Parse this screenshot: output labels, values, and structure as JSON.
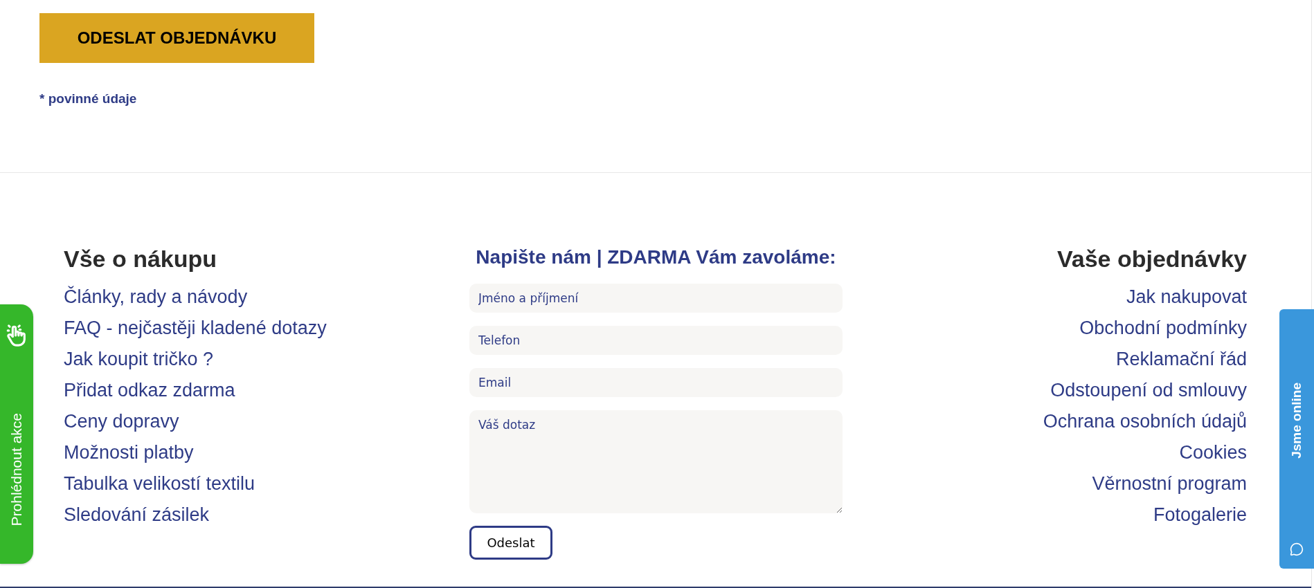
{
  "order_form": {
    "submit_button": "ODESLAT OBJEDNÁVKU",
    "required_note": "* povinné údaje"
  },
  "footer": {
    "shopping_info": {
      "title": "Vše o nákupu",
      "links": [
        "Články, rady a návody",
        "FAQ - nejčastěji kladené dotazy",
        "Jak koupit tričko ?",
        "Přidat odkaz zdarma",
        "Ceny dopravy",
        "Možnosti platby",
        "Tabulka velikostí textilu",
        "Sledování zásilek"
      ]
    },
    "contact_form": {
      "title": "Napište nám | ZDARMA Vám zavoláme:",
      "fields": [
        {
          "kind": "input",
          "placeholder": "Jméno a příjmení"
        },
        {
          "kind": "input",
          "placeholder": "Telefon"
        },
        {
          "kind": "input",
          "placeholder": "Email"
        },
        {
          "kind": "textarea",
          "placeholder": "Váš dotaz"
        }
      ],
      "submit_button": "Odeslat"
    },
    "your_orders": {
      "title": "Vaše objednávky",
      "links": [
        "Jak nakupovat",
        "Obchodní podmínky",
        "Reklamační řád",
        "Odstoupení od smlouvy",
        "Ochrana osobních údajů",
        "Cookies",
        "Věrnostní program",
        "Fotogalerie"
      ]
    }
  },
  "promo_tab": {
    "label": "Prohlédnout akce"
  },
  "chat_tab": {
    "label": "Jsme online"
  }
}
